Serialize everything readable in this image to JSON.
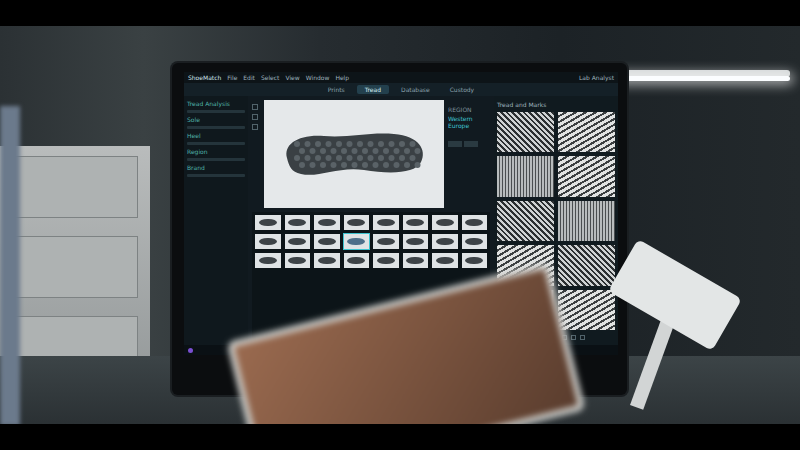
{
  "menu": {
    "app": "ShoeMatch",
    "items": [
      "File",
      "Edit",
      "Select",
      "View",
      "Window",
      "Help"
    ],
    "user": "Lab Analyst"
  },
  "tabs": [
    {
      "label": "Prints",
      "selected": false
    },
    {
      "label": "Tread",
      "selected": true
    },
    {
      "label": "Database",
      "selected": false
    },
    {
      "label": "Custody",
      "selected": false
    }
  ],
  "sidebar": {
    "items": [
      "Tread Analysis",
      "Sole",
      "Heel",
      "Region",
      "Brand"
    ]
  },
  "info": {
    "label": "REGION",
    "value": "Western Europe"
  },
  "thumbnails": [
    {
      "selected": false
    },
    {
      "selected": false
    },
    {
      "selected": false
    },
    {
      "selected": false
    },
    {
      "selected": false
    },
    {
      "selected": false
    },
    {
      "selected": false
    },
    {
      "selected": false
    },
    {
      "selected": false
    },
    {
      "selected": false
    },
    {
      "selected": false
    },
    {
      "selected": true
    },
    {
      "selected": false
    },
    {
      "selected": false
    },
    {
      "selected": false
    },
    {
      "selected": false
    },
    {
      "selected": false
    },
    {
      "selected": false
    },
    {
      "selected": false
    },
    {
      "selected": false
    },
    {
      "selected": false
    },
    {
      "selected": false
    },
    {
      "selected": false
    },
    {
      "selected": false
    }
  ],
  "right_panel": {
    "title": "Tread and Marks"
  }
}
